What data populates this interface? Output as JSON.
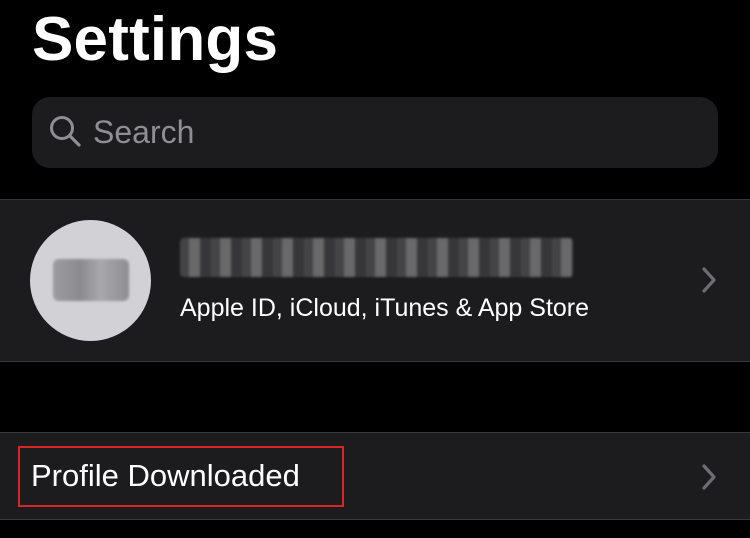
{
  "screen": {
    "title": "Settings"
  },
  "search": {
    "placeholder": "Search",
    "icon": "search-icon"
  },
  "account": {
    "name_redacted": true,
    "subtitle": "Apple ID, iCloud, iTunes & App Store",
    "avatar_icon": "avatar",
    "chevron_icon": "chevron-right-icon"
  },
  "profile_downloaded": {
    "label": "Profile Downloaded",
    "chevron_icon": "chevron-right-icon",
    "highlighted": true
  },
  "colors": {
    "background": "#000000",
    "cell_background": "#1c1c1e",
    "separator": "#38383a",
    "text_primary": "#ffffff",
    "text_secondary": "#8e8e93",
    "highlight": "#d82626"
  }
}
